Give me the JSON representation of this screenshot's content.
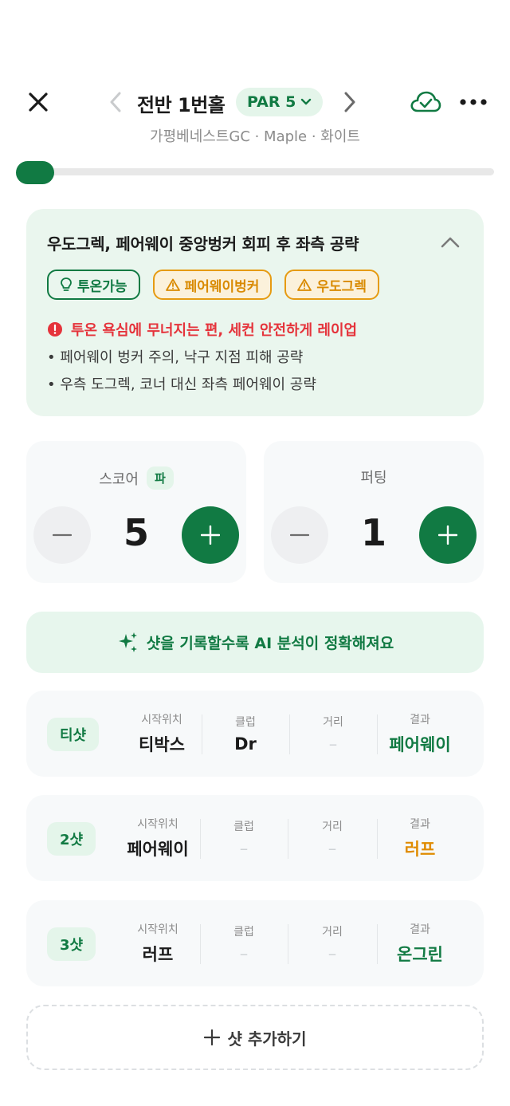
{
  "header": {
    "hole_title": "전반 1번홀",
    "par_label": "PAR 5",
    "subtitle": "가평베네스트GC · Maple · 화이트"
  },
  "progress": {
    "fraction": 0.08
  },
  "strategy": {
    "title": "우도그렉, 페어웨이 중앙벙커 회피 후 좌측 공략",
    "tags": [
      {
        "label": "투온가능",
        "icon": "lightbulb-icon",
        "color": "#117a43"
      },
      {
        "label": "페어웨이벙커",
        "icon": "warning-icon",
        "color": "#e69b12"
      },
      {
        "label": "우도그렉",
        "icon": "warning-icon",
        "color": "#e69b12"
      }
    ],
    "warning": "투온 욕심에 무너지는 편, 세컨 안전하게 레이업",
    "bullets": [
      "• 페어웨이 벙커 주의, 낙구 지점 피해 공략",
      "• 우측 도그렉, 코너 대신 좌측 페어웨이 공략"
    ]
  },
  "score": {
    "label": "스코어",
    "badge": "파",
    "value": "5"
  },
  "putting": {
    "label": "퍼팅",
    "value": "1"
  },
  "ai_banner": {
    "text": "샷을 기록할수록 AI 분석이 정확해져요"
  },
  "shot_columns": {
    "start": "시작위치",
    "club": "클럽",
    "distance": "거리",
    "result": "결과"
  },
  "shots": [
    {
      "badge": "티샷",
      "start": "티박스",
      "club": "Dr",
      "distance": "–",
      "result": "페어웨이",
      "result_color": "green"
    },
    {
      "badge": "2샷",
      "start": "페어웨이",
      "club": "–",
      "distance": "–",
      "result": "러프",
      "result_color": "orange"
    },
    {
      "badge": "3샷",
      "start": "러프",
      "club": "–",
      "distance": "–",
      "result": "온그린",
      "result_color": "green"
    }
  ],
  "add_shot": {
    "label": "샷 추가하기"
  },
  "colors": {
    "brand": "#117a43",
    "warning_red": "#e5333b",
    "warning_orange": "#e69b12"
  }
}
